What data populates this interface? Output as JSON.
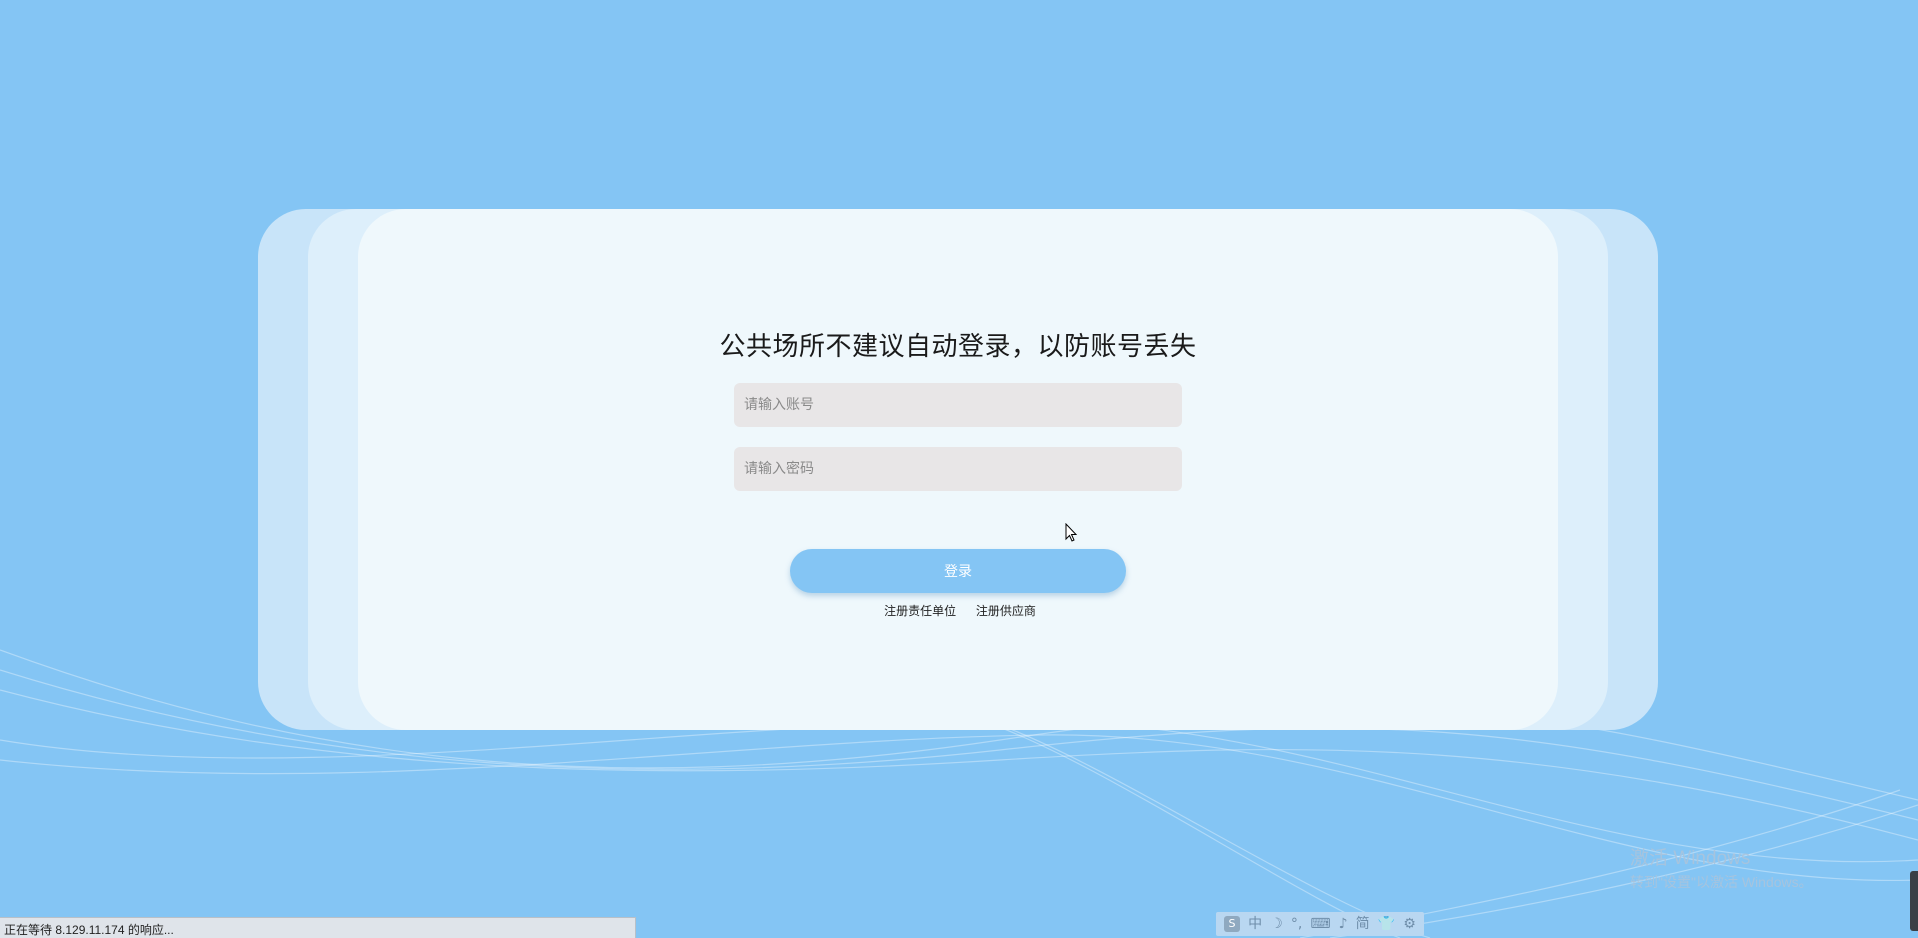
{
  "login": {
    "title": "公共场所不建议自动登录，以防账号丢失",
    "account_placeholder": "请输入账号",
    "account_value": "",
    "password_placeholder": "请输入密码",
    "password_value": "",
    "submit_label": "登录",
    "links": [
      {
        "label": "注册责任单位"
      },
      {
        "label": "注册供应商"
      }
    ]
  },
  "status_bar": {
    "text": "正在等待 8.129.11.174 的响应..."
  },
  "watermark": {
    "title": "激活 Windows",
    "subtitle": "转到\"设置\"以激活 Windows。"
  },
  "ime_toolbar": {
    "items": [
      {
        "icon": "sogou-logo-icon",
        "glyph": "S"
      },
      {
        "icon": "chinese-mode-icon",
        "glyph": "中"
      },
      {
        "icon": "half-width-moon-icon",
        "glyph": "☽"
      },
      {
        "icon": "punctuation-icon",
        "glyph": "°,"
      },
      {
        "icon": "keyboard-icon",
        "glyph": "⌨"
      },
      {
        "icon": "voice-icon",
        "glyph": "♪"
      },
      {
        "icon": "simplified-icon",
        "glyph": "简"
      },
      {
        "icon": "skin-shirt-icon",
        "glyph": "👕"
      },
      {
        "icon": "settings-gear-icon",
        "glyph": "⚙"
      }
    ]
  },
  "colors": {
    "background": "#84c5f4",
    "card_inner": "#eff8fc",
    "input_bg": "#e8e6e7",
    "button": "#84c5f4"
  }
}
